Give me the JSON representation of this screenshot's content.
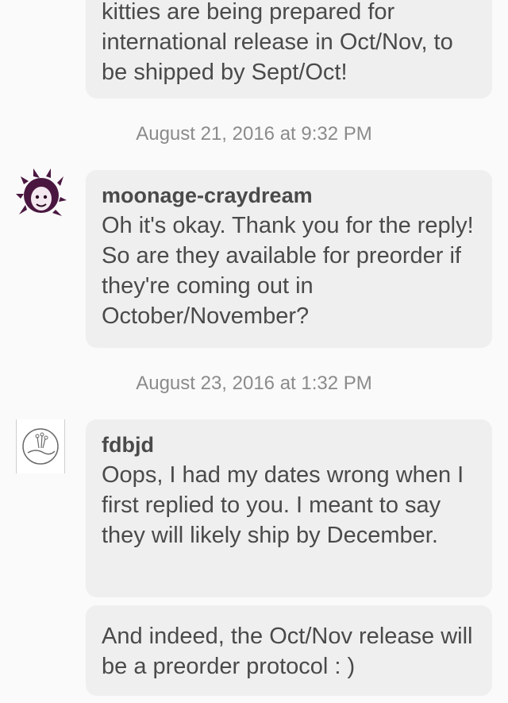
{
  "messages": [
    {
      "id": "m1",
      "sender": "",
      "text": "kitties are being prepared for international release in Oct/Nov, to be shipped by Sept/Oct!"
    },
    {
      "id": "m2",
      "timestamp": "August 21, 2016 at 9:32 PM",
      "sender": "moonage-craydream",
      "text": "Oh it's okay. Thank you for the reply! So are they available for preorder if they're coming out in October/November?"
    },
    {
      "id": "m3",
      "timestamp": "August 23, 2016 at 1:32 PM",
      "sender": "fdbjd",
      "text": "Oops, I had my dates wrong when I first replied to you. I meant to say they will likely ship by December."
    },
    {
      "id": "m4",
      "sender": "",
      "text": "And indeed, the Oct/Nov release will be a preorder protocol : )"
    }
  ],
  "avatars": {
    "moonage": {
      "icon": "avatar-moonage-craydream-icon",
      "color": "#5a1f4a"
    },
    "fdbjd": {
      "icon": "avatar-fdbjd-icon",
      "color": "#6a6a6a"
    }
  },
  "colors": {
    "background": "#fafafa",
    "bubble": "#efefef",
    "text": "#4a4a4a",
    "timestamp": "#8b8b8b"
  }
}
